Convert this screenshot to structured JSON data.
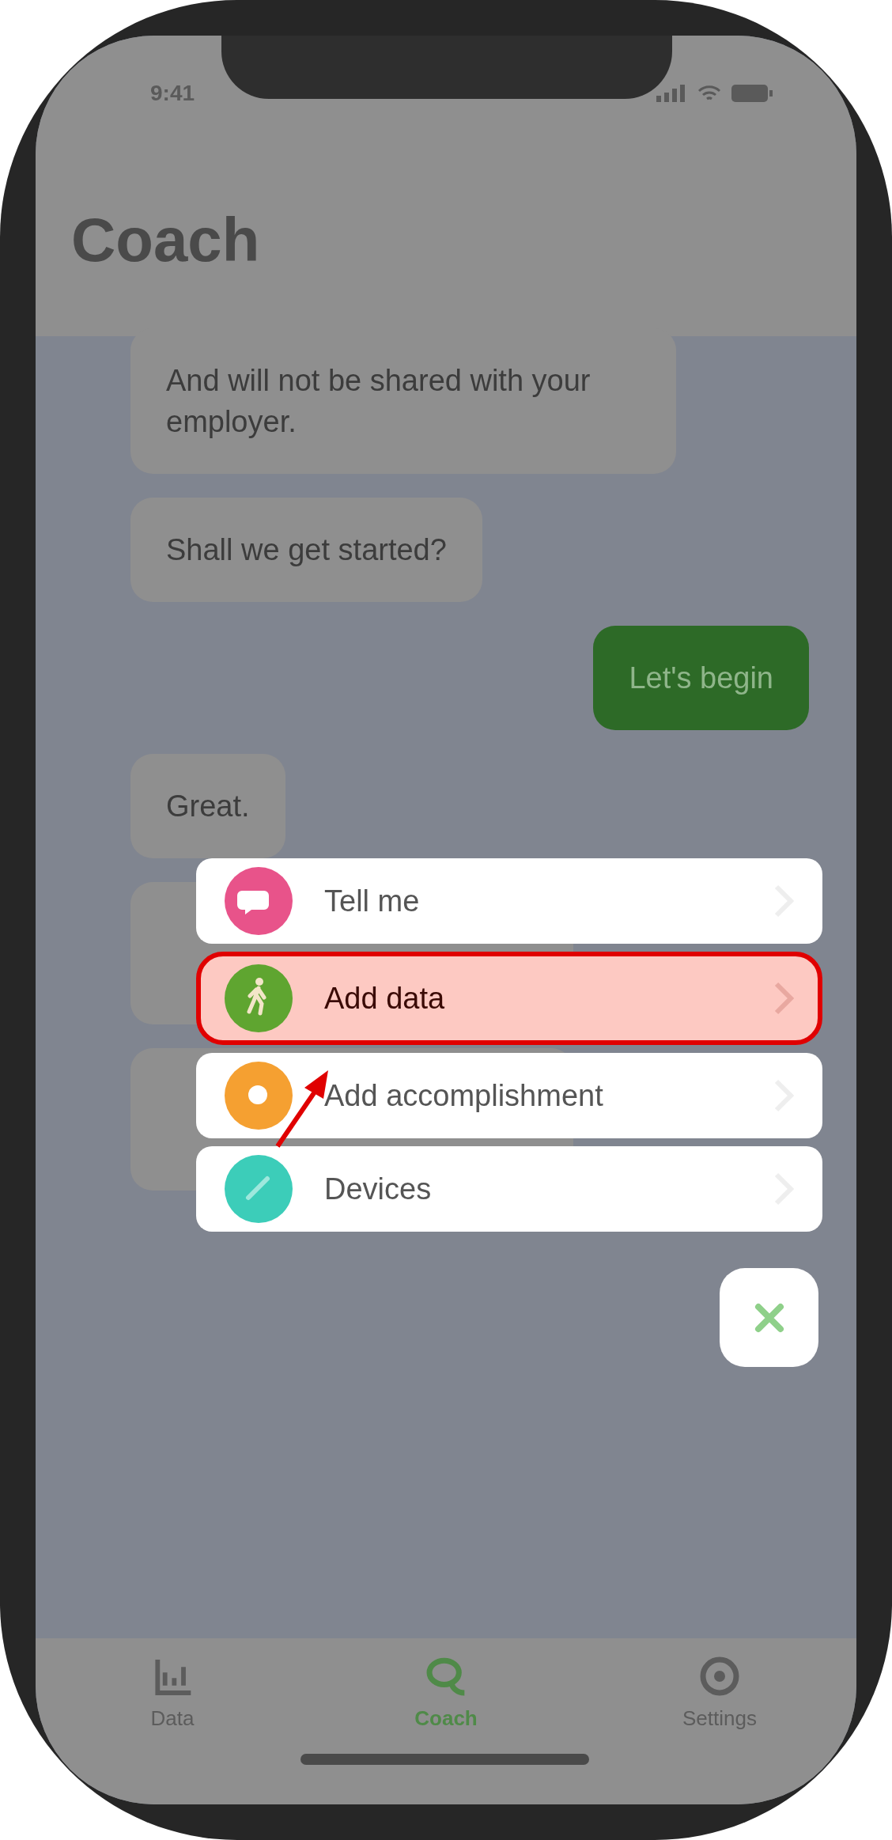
{
  "status_bar": {
    "time": "9:41"
  },
  "header": {
    "title": "Coach"
  },
  "messages": [
    {
      "kind": "received",
      "text": "And will not be shared with your employer."
    },
    {
      "kind": "received",
      "text": "Shall we get started?"
    },
    {
      "kind": "sent",
      "text": "Let's begin"
    },
    {
      "kind": "received",
      "text": "Great."
    },
    {
      "kind": "received"
    },
    {
      "kind": "received"
    }
  ],
  "menu": [
    {
      "label": "Tell me",
      "color": "#e8538a",
      "selected": false
    },
    {
      "label": "Add data",
      "color": "#5fa530",
      "selected": true
    },
    {
      "label": "Add accomplishment",
      "color": "#f5a031",
      "selected": false
    },
    {
      "label": "Devices",
      "color": "#3ccdb9",
      "selected": false
    }
  ],
  "tab_bar": [
    {
      "label": "Data",
      "selected": false
    },
    {
      "label": "Coach",
      "selected": true
    },
    {
      "label": "Settings",
      "selected": false
    }
  ]
}
